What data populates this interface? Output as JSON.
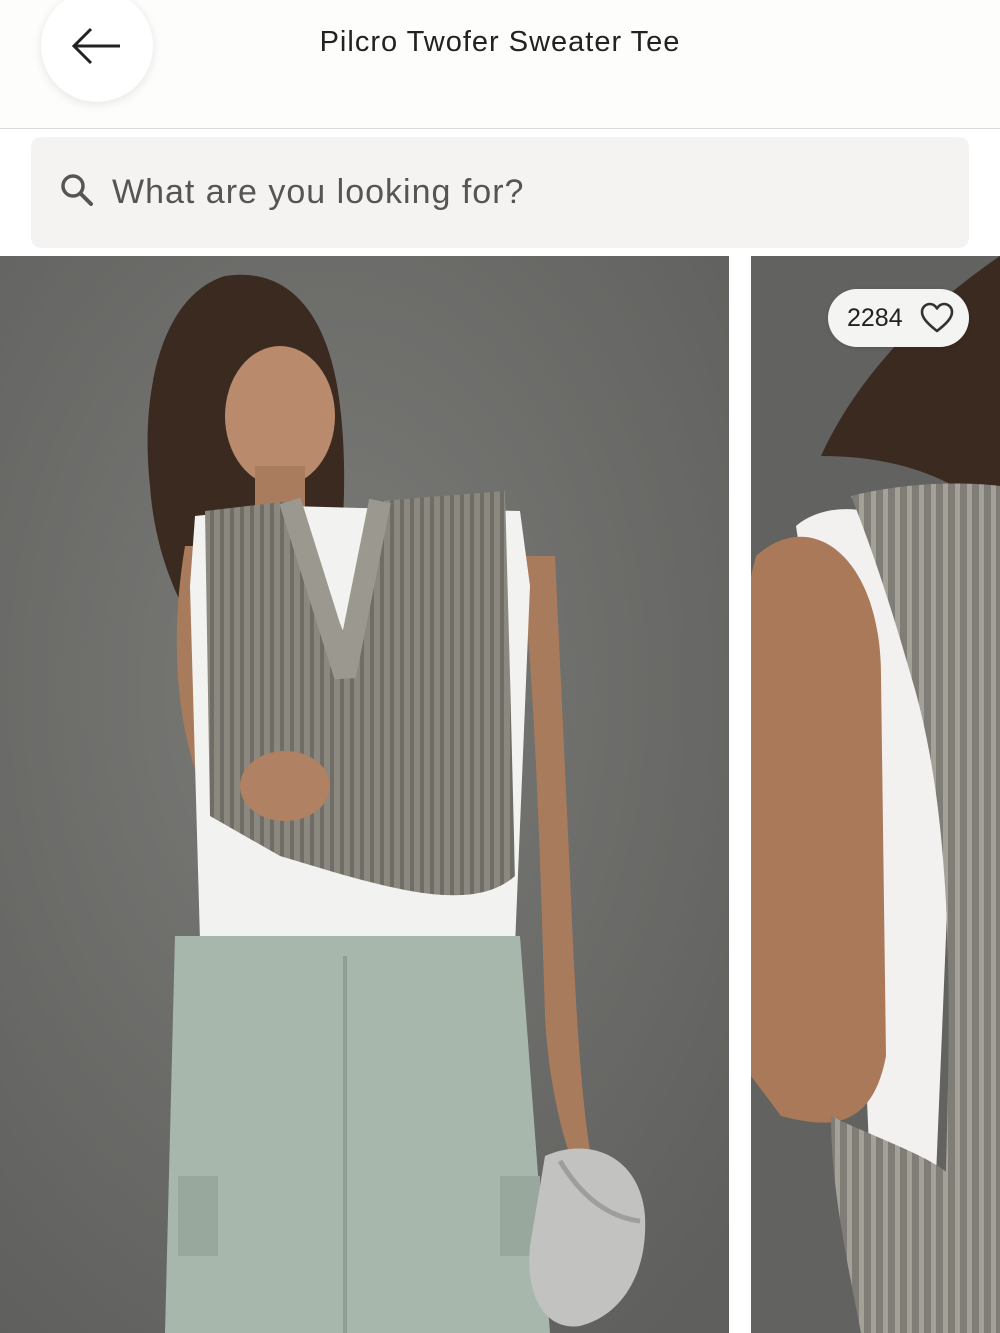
{
  "header": {
    "title": "Pilcro Twofer Sweater Tee",
    "back_icon": "arrow-left-icon"
  },
  "search": {
    "placeholder": "What are you looking for?",
    "icon": "search-icon"
  },
  "gallery": {
    "images": [
      {
        "description_name": "model-front-photo"
      },
      {
        "description_name": "vest-detail-photo"
      }
    ],
    "likes": {
      "count": "2284",
      "icon": "heart-icon"
    }
  },
  "colors": {
    "background": "#ffffff",
    "search_background": "#f4f3f1",
    "photo_background": "#6c6c6a"
  }
}
